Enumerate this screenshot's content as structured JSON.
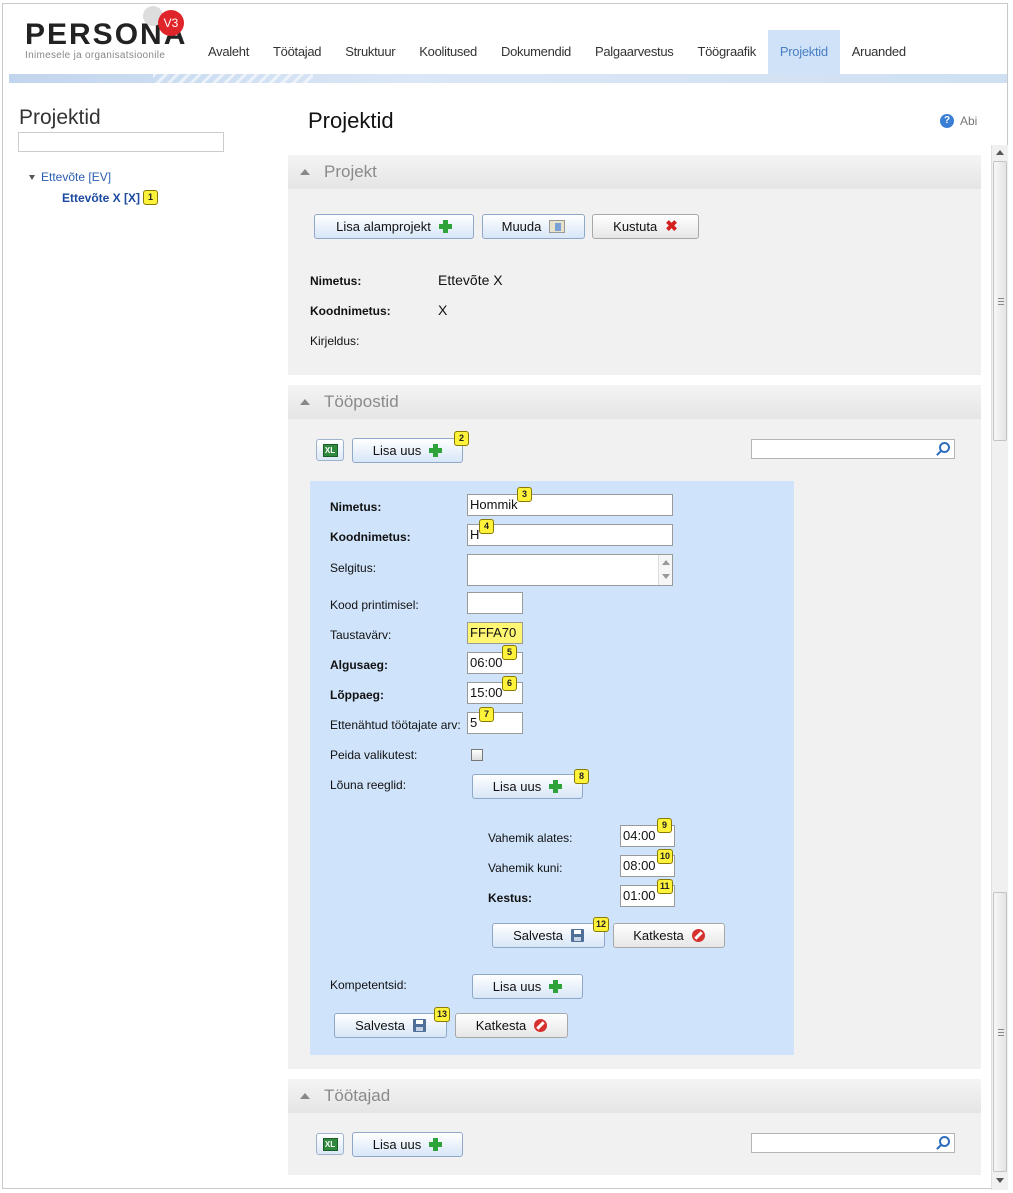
{
  "brand": {
    "name": "PERSONA",
    "version": "V3",
    "tagline": "Inimesele ja organisatsioonile"
  },
  "nav": [
    {
      "label": "Avaleht"
    },
    {
      "label": "Töötajad"
    },
    {
      "label": "Struktuur"
    },
    {
      "label": "Koolitused"
    },
    {
      "label": "Dokumendid"
    },
    {
      "label": "Palgaarvestus"
    },
    {
      "label": "Töögraafik"
    },
    {
      "label": "Projektid",
      "active": true
    },
    {
      "label": "Aruanded"
    }
  ],
  "sidebar": {
    "title": "Projektid",
    "search_value": "",
    "tree": {
      "root": "Ettevõte [EV]",
      "child": "Ettevõte X [X]"
    }
  },
  "page": {
    "title": "Projektid",
    "help": "Abi"
  },
  "projekt": {
    "heading": "Projekt",
    "buttons": {
      "add_sub": "Lisa alamprojekt",
      "edit": "Muuda",
      "delete": "Kustuta"
    },
    "fields": {
      "name_label": "Nimetus:",
      "name_value": "Ettevõte X",
      "code_label": "Koodnimetus:",
      "code_value": "X",
      "desc_label": "Kirjeldus:"
    }
  },
  "toopostid": {
    "heading": "Tööpostid",
    "add_label": "Lisa uus",
    "search_value": "",
    "form": {
      "name_label": "Nimetus:",
      "name_value": "Hommik",
      "code_label": "Koodnimetus:",
      "code_value": "H",
      "desc_label": "Selgitus:",
      "print_label": "Kood printimisel:",
      "print_value": "",
      "bg_label": "Taustavärv:",
      "bg_value": "FFFA70",
      "start_label": "Algusaeg:",
      "start_value": "06:00",
      "end_label": "Lõppaeg:",
      "end_value": "15:00",
      "staff_label": "Ettenähtud töötajate arv:",
      "staff_value": "5",
      "hide_label": "Peida valikutest:",
      "hide_checked": false,
      "lunch_label": "Lõuna reeglid:",
      "lunch_add": "Lisa uus",
      "lunch": {
        "from_label": "Vahemik alates:",
        "from_value": "04:00",
        "to_label": "Vahemik kuni:",
        "to_value": "08:00",
        "dur_label": "Kestus:",
        "dur_value": "01:00",
        "save": "Salvesta",
        "cancel": "Katkesta"
      },
      "comp_label": "Kompetentsid:",
      "comp_add": "Lisa uus",
      "save": "Salvesta",
      "cancel": "Katkesta"
    }
  },
  "tootajad": {
    "heading": "Töötajad",
    "add_label": "Lisa uus",
    "search_value": ""
  },
  "badges": [
    "1",
    "2",
    "3",
    "4",
    "5",
    "6",
    "7",
    "8",
    "9",
    "10",
    "11",
    "12",
    "13"
  ],
  "colors": {
    "accent": "#4a7fc3",
    "panel": "#cfe3fb",
    "badge": "#fff23a",
    "highlight_input": "#fff673"
  },
  "icons": {
    "excel": "XL"
  }
}
